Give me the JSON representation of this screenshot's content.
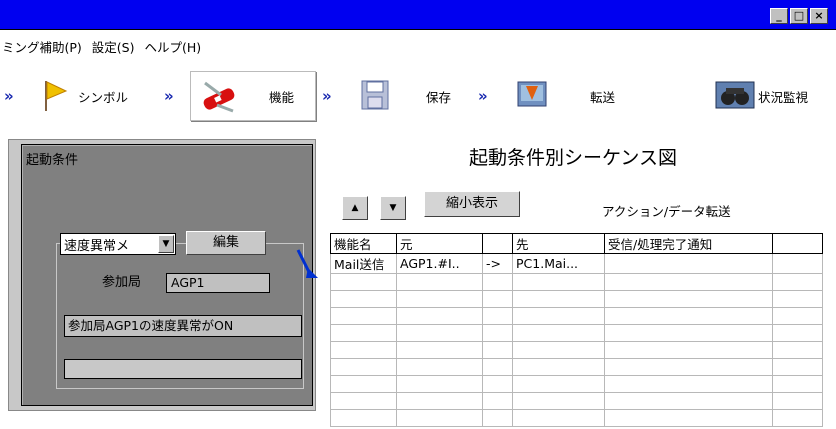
{
  "window": {
    "buttons": [
      "_",
      "□",
      "×"
    ]
  },
  "menu": [
    "ミング補助(P)",
    "設定(S)",
    "ヘルプ(H)"
  ],
  "toolbar": {
    "symbol_label": "シンボル",
    "function_label": "機能",
    "save_label": "保存",
    "transfer_label": "転送",
    "monitor_label": "状況監視",
    "chevron": "»"
  },
  "left": {
    "title": "起動条件",
    "select_value": "速度異常メ",
    "edit_label": "編集",
    "station_label": "参加局",
    "station_value": "AGP1",
    "condition_text": "参加局AGP1の速度異常がON"
  },
  "right": {
    "title": "起動条件別シーケンス図",
    "up_label": "▲",
    "down_label": "▼",
    "shrink_label": "縮小表示",
    "action_label": "アクション/データ転送",
    "columns": [
      "機能名",
      "元",
      "",
      "先",
      "受信/処理完了通知",
      ""
    ],
    "rows": [
      [
        "Mail送信",
        "AGP1.#I..",
        "->",
        "PC1.Mai...",
        "",
        ""
      ],
      [
        "",
        "",
        "",
        "",
        "",
        ""
      ],
      [
        "",
        "",
        "",
        "",
        "",
        ""
      ],
      [
        "",
        "",
        "",
        "",
        "",
        ""
      ],
      [
        "",
        "",
        "",
        "",
        "",
        ""
      ],
      [
        "",
        "",
        "",
        "",
        "",
        ""
      ],
      [
        "",
        "",
        "",
        "",
        "",
        ""
      ],
      [
        "",
        "",
        "",
        "",
        "",
        ""
      ],
      [
        "",
        "",
        "",
        "",
        "",
        ""
      ],
      [
        "",
        "",
        "",
        "",
        "",
        ""
      ]
    ]
  },
  "colors": {
    "titlebar": "#0000f0",
    "panel_dark": "#808080",
    "panel_light": "#c8c8c8",
    "accent_blue": "#1a2ab0"
  }
}
